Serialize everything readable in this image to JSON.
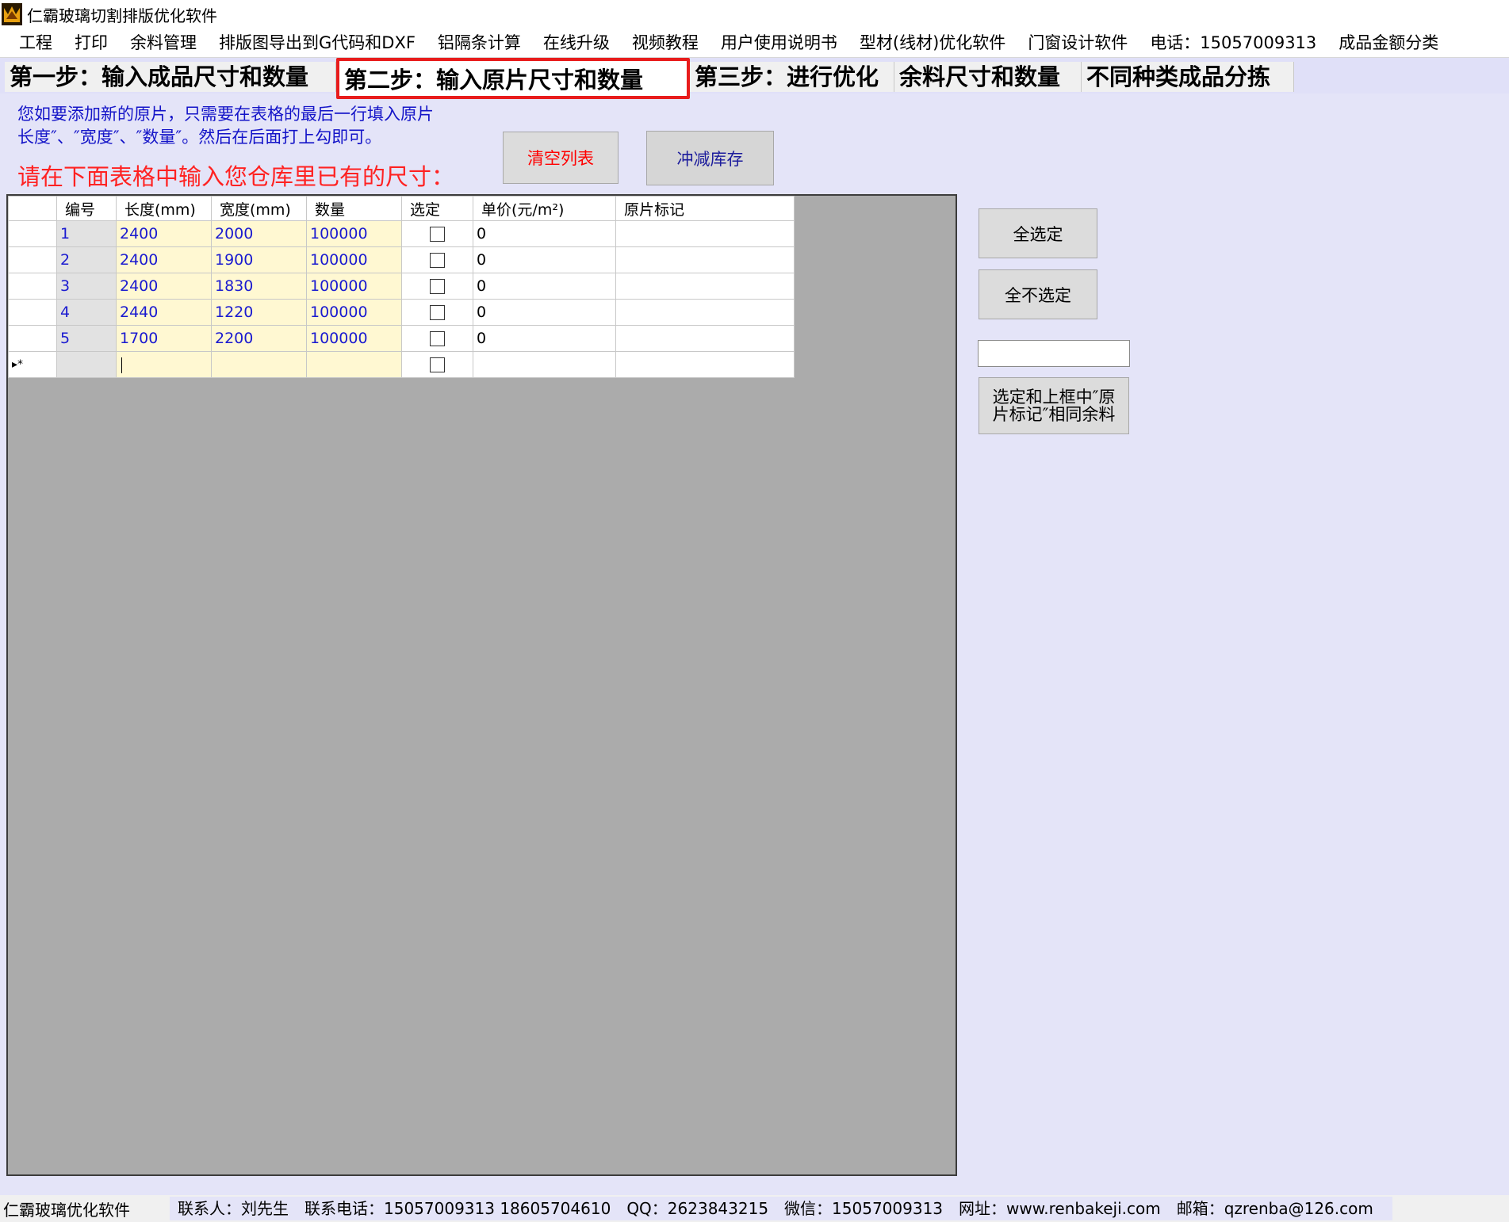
{
  "window": {
    "title": "仁霸玻璃切割排版优化软件",
    "icon": "app-logo-icon"
  },
  "menu": [
    "工程",
    "打印",
    "余料管理",
    "排版图导出到G代码和DXF",
    "铝隔条计算",
    "在线升级",
    "视频教程",
    "用户使用说明书",
    "型材(线材)优化软件",
    "门窗设计软件",
    "电话：15057009313",
    "成品金额分类"
  ],
  "tabs": [
    "第一步：输入成品尺寸和数量",
    "第二步：输入原片尺寸和数量",
    "第三步：进行优化",
    "余料尺寸和数量",
    "不同种类成品分拣"
  ],
  "active_tab": "第二步：输入原片尺寸和数量",
  "hints": {
    "line1": "您如要添加新的原片，只需要在表格的最后一行填入原片",
    "line2": "长度″、″宽度″、″数量″。然后在后面打上勾即可。",
    "red": "请在下面表格中输入您仓库里已有的尺寸："
  },
  "buttons": {
    "clear": "清空列表",
    "deduct": "冲减库存",
    "select_all": "全选定",
    "select_none": "全不选定",
    "select_mark_line1": "选定和上框中″原",
    "select_mark_line2": "片标记″相同余料"
  },
  "mark_input": {
    "value": ""
  },
  "table": {
    "headers": [
      "编号",
      "长度(mm)",
      "宽度(mm)",
      "数量",
      "选定",
      "单价(元/m²)",
      "原片标记"
    ],
    "rows": [
      {
        "id": "1",
        "length": "2400",
        "width": "2000",
        "qty": "100000",
        "selected": false,
        "price": "0",
        "mark": ""
      },
      {
        "id": "2",
        "length": "2400",
        "width": "1900",
        "qty": "100000",
        "selected": false,
        "price": "0",
        "mark": ""
      },
      {
        "id": "3",
        "length": "2400",
        "width": "1830",
        "qty": "100000",
        "selected": false,
        "price": "0",
        "mark": ""
      },
      {
        "id": "4",
        "length": "2440",
        "width": "1220",
        "qty": "100000",
        "selected": false,
        "price": "0",
        "mark": ""
      },
      {
        "id": "5",
        "length": "1700",
        "width": "2200",
        "qty": "100000",
        "selected": false,
        "price": "0",
        "mark": ""
      }
    ],
    "new_row_marker": "▸*"
  },
  "status": {
    "app": "仁霸玻璃优化软件",
    "contact": "联系人：刘先生",
    "phone": "联系电话：15057009313 18605704610",
    "qq": "QQ：2623843215",
    "wechat": "微信：15057009313",
    "website": "网址：www.renbakeji.com",
    "email": "邮箱：qzrenba@126.com"
  },
  "colors": {
    "accent_red": "#e81c1c",
    "panel_bg": "#e4e4f8",
    "hint_blue": "#1414c8",
    "cell_yellow": "#fff8d2"
  }
}
